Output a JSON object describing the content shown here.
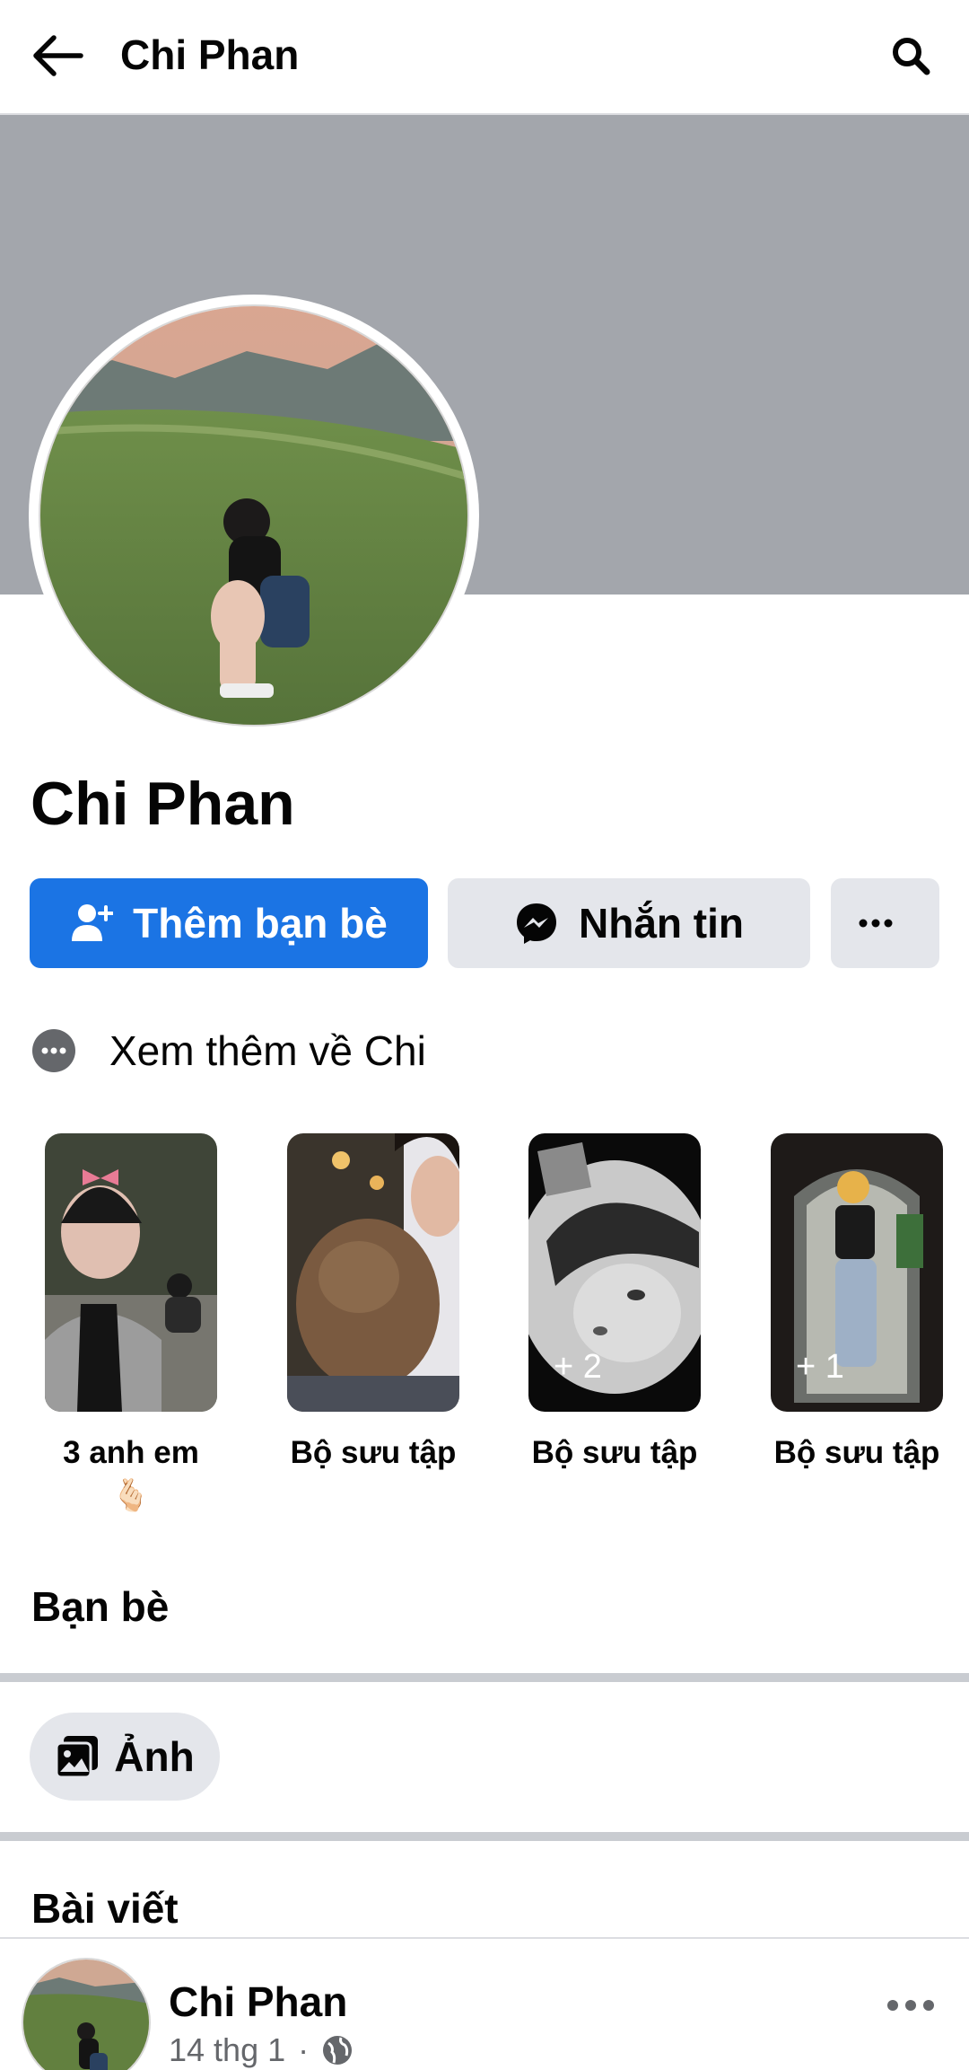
{
  "topbar": {
    "title": "Chi Phan",
    "back_icon": "arrow-left-icon",
    "search_icon": "search-icon"
  },
  "profile": {
    "name": "Chi Phan"
  },
  "actions": {
    "add_friend": "Thêm bạn bè",
    "message": "Nhắn tin",
    "more_icon": "ellipsis-icon"
  },
  "about": {
    "label": "Xem thêm về Chi"
  },
  "highlights": [
    {
      "label": "3 anh em",
      "emoji": "🫰🏻",
      "count": ""
    },
    {
      "label": "Bộ sưu tập",
      "emoji": "",
      "count": ""
    },
    {
      "label": "Bộ sưu tập",
      "emoji": "",
      "count": "+ 2"
    },
    {
      "label": "Bộ sưu tập",
      "emoji": "",
      "count": "+ 1"
    }
  ],
  "sections": {
    "friends": "Bạn bè",
    "photos": "Ảnh",
    "posts": "Bài viết"
  },
  "post": {
    "author": "Chi Phan",
    "date": "14 thg 1",
    "separator": "·",
    "privacy_icon": "globe-icon",
    "more_icon": "ellipsis-icon"
  },
  "colors": {
    "primary": "#1b74e4",
    "cover": "#a3a6ac",
    "button_gray": "#e4e6eb",
    "secondary_text": "#65676b"
  }
}
